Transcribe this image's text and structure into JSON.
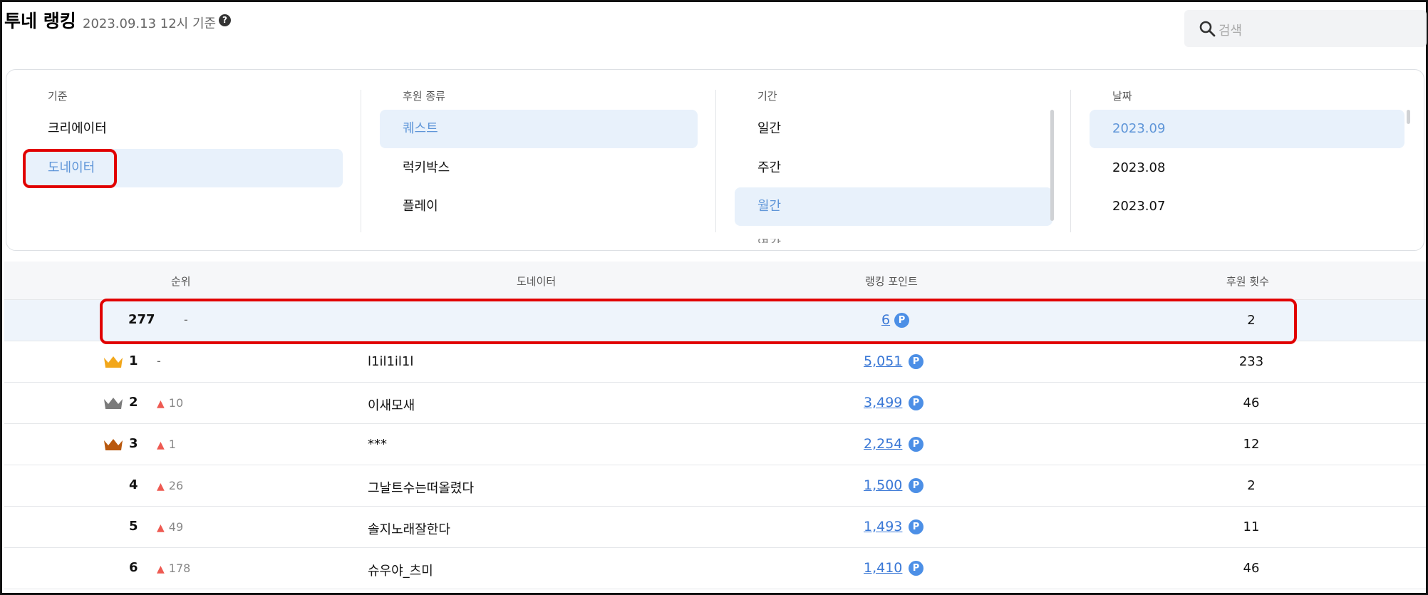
{
  "header": {
    "title": "투네 랭킹",
    "subtitle": "2023.09.13 12시 기준",
    "help_icon": "question-circle-icon",
    "search_placeholder": "검색"
  },
  "filters": {
    "criteria": {
      "label": "기준",
      "options": [
        "크리에이터",
        "도네이터"
      ],
      "selected": "도네이터"
    },
    "support_type": {
      "label": "후원 종류",
      "options": [
        "퀘스트",
        "럭키박스",
        "플레이"
      ],
      "selected": "퀘스트"
    },
    "period": {
      "label": "기간",
      "options": [
        "일간",
        "주간",
        "월간"
      ],
      "selected": "월간"
    },
    "date": {
      "label": "날짜",
      "options": [
        "2023.09",
        "2023.08",
        "2023.07"
      ],
      "selected": "2023.09"
    }
  },
  "table": {
    "columns": [
      "순위",
      "도네이터",
      "랭킹 포인트",
      "후원 횟수"
    ],
    "my_row": {
      "rank": "277",
      "change": "-",
      "name": "",
      "points": "6",
      "count": "2"
    },
    "rows": [
      {
        "rank": "1",
        "crown": "gold",
        "change": "-",
        "name": "l1il1il1l",
        "points": "5,051",
        "count": "233"
      },
      {
        "rank": "2",
        "crown": "silver",
        "change": "10",
        "name": "이새모새",
        "points": "3,499",
        "count": "46"
      },
      {
        "rank": "3",
        "crown": "bronze",
        "change": "1",
        "name": "***",
        "points": "2,254",
        "count": "12"
      },
      {
        "rank": "4",
        "crown": "",
        "change": "26",
        "name": "그날트수는떠올렸다",
        "points": "1,500",
        "count": "2"
      },
      {
        "rank": "5",
        "crown": "",
        "change": "49",
        "name": "솔지노래잘한다",
        "points": "1,493",
        "count": "11"
      },
      {
        "rank": "6",
        "crown": "",
        "change": "178",
        "name": "슈우야_츠미",
        "points": "1,410",
        "count": "46"
      }
    ]
  },
  "colors": {
    "accent": "#5e95d8",
    "selected_bg": "#e8f1fb",
    "point_badge": "#4c8fe6",
    "rank_up": "#ee5a52",
    "highlight": "#e10000",
    "crown_gold": "#f2a71b",
    "crown_silver": "#7b7b7b",
    "crown_bronze": "#b9590f"
  },
  "point_badge_label": "P"
}
